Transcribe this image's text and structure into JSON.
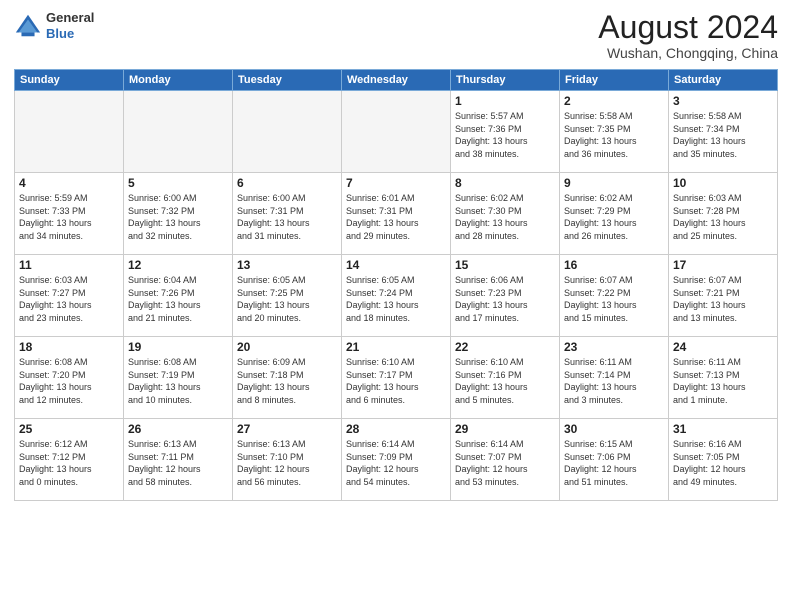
{
  "header": {
    "logo_general": "General",
    "logo_blue": "Blue",
    "month_year": "August 2024",
    "location": "Wushan, Chongqing, China"
  },
  "weekdays": [
    "Sunday",
    "Monday",
    "Tuesday",
    "Wednesday",
    "Thursday",
    "Friday",
    "Saturday"
  ],
  "weeks": [
    [
      {
        "day": "",
        "info": ""
      },
      {
        "day": "",
        "info": ""
      },
      {
        "day": "",
        "info": ""
      },
      {
        "day": "",
        "info": ""
      },
      {
        "day": "1",
        "info": "Sunrise: 5:57 AM\nSunset: 7:36 PM\nDaylight: 13 hours\nand 38 minutes."
      },
      {
        "day": "2",
        "info": "Sunrise: 5:58 AM\nSunset: 7:35 PM\nDaylight: 13 hours\nand 36 minutes."
      },
      {
        "day": "3",
        "info": "Sunrise: 5:58 AM\nSunset: 7:34 PM\nDaylight: 13 hours\nand 35 minutes."
      }
    ],
    [
      {
        "day": "4",
        "info": "Sunrise: 5:59 AM\nSunset: 7:33 PM\nDaylight: 13 hours\nand 34 minutes."
      },
      {
        "day": "5",
        "info": "Sunrise: 6:00 AM\nSunset: 7:32 PM\nDaylight: 13 hours\nand 32 minutes."
      },
      {
        "day": "6",
        "info": "Sunrise: 6:00 AM\nSunset: 7:31 PM\nDaylight: 13 hours\nand 31 minutes."
      },
      {
        "day": "7",
        "info": "Sunrise: 6:01 AM\nSunset: 7:31 PM\nDaylight: 13 hours\nand 29 minutes."
      },
      {
        "day": "8",
        "info": "Sunrise: 6:02 AM\nSunset: 7:30 PM\nDaylight: 13 hours\nand 28 minutes."
      },
      {
        "day": "9",
        "info": "Sunrise: 6:02 AM\nSunset: 7:29 PM\nDaylight: 13 hours\nand 26 minutes."
      },
      {
        "day": "10",
        "info": "Sunrise: 6:03 AM\nSunset: 7:28 PM\nDaylight: 13 hours\nand 25 minutes."
      }
    ],
    [
      {
        "day": "11",
        "info": "Sunrise: 6:03 AM\nSunset: 7:27 PM\nDaylight: 13 hours\nand 23 minutes."
      },
      {
        "day": "12",
        "info": "Sunrise: 6:04 AM\nSunset: 7:26 PM\nDaylight: 13 hours\nand 21 minutes."
      },
      {
        "day": "13",
        "info": "Sunrise: 6:05 AM\nSunset: 7:25 PM\nDaylight: 13 hours\nand 20 minutes."
      },
      {
        "day": "14",
        "info": "Sunrise: 6:05 AM\nSunset: 7:24 PM\nDaylight: 13 hours\nand 18 minutes."
      },
      {
        "day": "15",
        "info": "Sunrise: 6:06 AM\nSunset: 7:23 PM\nDaylight: 13 hours\nand 17 minutes."
      },
      {
        "day": "16",
        "info": "Sunrise: 6:07 AM\nSunset: 7:22 PM\nDaylight: 13 hours\nand 15 minutes."
      },
      {
        "day": "17",
        "info": "Sunrise: 6:07 AM\nSunset: 7:21 PM\nDaylight: 13 hours\nand 13 minutes."
      }
    ],
    [
      {
        "day": "18",
        "info": "Sunrise: 6:08 AM\nSunset: 7:20 PM\nDaylight: 13 hours\nand 12 minutes."
      },
      {
        "day": "19",
        "info": "Sunrise: 6:08 AM\nSunset: 7:19 PM\nDaylight: 13 hours\nand 10 minutes."
      },
      {
        "day": "20",
        "info": "Sunrise: 6:09 AM\nSunset: 7:18 PM\nDaylight: 13 hours\nand 8 minutes."
      },
      {
        "day": "21",
        "info": "Sunrise: 6:10 AM\nSunset: 7:17 PM\nDaylight: 13 hours\nand 6 minutes."
      },
      {
        "day": "22",
        "info": "Sunrise: 6:10 AM\nSunset: 7:16 PM\nDaylight: 13 hours\nand 5 minutes."
      },
      {
        "day": "23",
        "info": "Sunrise: 6:11 AM\nSunset: 7:14 PM\nDaylight: 13 hours\nand 3 minutes."
      },
      {
        "day": "24",
        "info": "Sunrise: 6:11 AM\nSunset: 7:13 PM\nDaylight: 13 hours\nand 1 minute."
      }
    ],
    [
      {
        "day": "25",
        "info": "Sunrise: 6:12 AM\nSunset: 7:12 PM\nDaylight: 13 hours\nand 0 minutes."
      },
      {
        "day": "26",
        "info": "Sunrise: 6:13 AM\nSunset: 7:11 PM\nDaylight: 12 hours\nand 58 minutes."
      },
      {
        "day": "27",
        "info": "Sunrise: 6:13 AM\nSunset: 7:10 PM\nDaylight: 12 hours\nand 56 minutes."
      },
      {
        "day": "28",
        "info": "Sunrise: 6:14 AM\nSunset: 7:09 PM\nDaylight: 12 hours\nand 54 minutes."
      },
      {
        "day": "29",
        "info": "Sunrise: 6:14 AM\nSunset: 7:07 PM\nDaylight: 12 hours\nand 53 minutes."
      },
      {
        "day": "30",
        "info": "Sunrise: 6:15 AM\nSunset: 7:06 PM\nDaylight: 12 hours\nand 51 minutes."
      },
      {
        "day": "31",
        "info": "Sunrise: 6:16 AM\nSunset: 7:05 PM\nDaylight: 12 hours\nand 49 minutes."
      }
    ]
  ]
}
